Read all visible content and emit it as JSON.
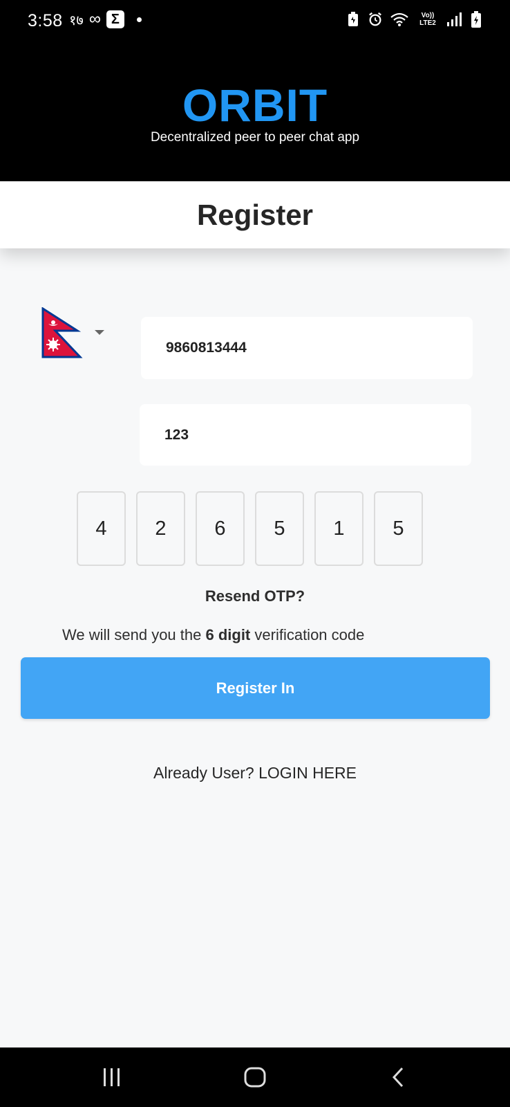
{
  "status_bar": {
    "time": "3:58",
    "left_extra": "१७",
    "sigma": "Σ",
    "lte_top": "Vo))",
    "lte_bottom": "LTE2"
  },
  "header": {
    "app_title": "ORBIT",
    "subtitle": "Decentralized peer to peer chat app"
  },
  "page": {
    "title": "Register"
  },
  "form": {
    "country_flag": "nepal-flag",
    "phone_value": "9860813444",
    "code_value": "123",
    "otp_digits": [
      "4",
      "2",
      "6",
      "5",
      "1",
      "5"
    ],
    "resend_label": "Resend OTP?",
    "info_prefix": "We will send you the ",
    "info_bold": "6 digit",
    "info_suffix": " verification code",
    "register_button": "Register In",
    "login_link": "Already User? LOGIN HERE"
  },
  "colors": {
    "brand": "#2196f3",
    "button": "#42a5f5",
    "background": "#f7f8f9"
  },
  "nav": {
    "icons": [
      "recent-apps-icon",
      "home-icon",
      "back-icon"
    ]
  }
}
